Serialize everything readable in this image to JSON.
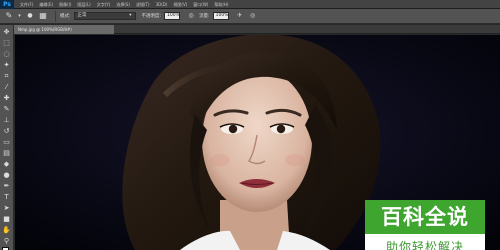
{
  "app": {
    "logo": "Ps"
  },
  "menu": [
    "文件(F)",
    "编辑(E)",
    "图像(I)",
    "图层(L)",
    "文字(Y)",
    "选择(S)",
    "滤镜(T)",
    "3D(D)",
    "视图(V)",
    "窗口(W)",
    "帮助(H)"
  ],
  "options": {
    "mode_label": "模式:",
    "mode_value": "正常",
    "opacity_label": "不透明度:",
    "opacity_value": "100%",
    "flow_label": "流量:",
    "flow_value": "100%"
  },
  "document": {
    "tab_title": "Nmp.jpg @ 100%(RGB/8#)"
  },
  "watermark": {
    "title": "百科全说",
    "subtitle": "助你轻松解决"
  }
}
